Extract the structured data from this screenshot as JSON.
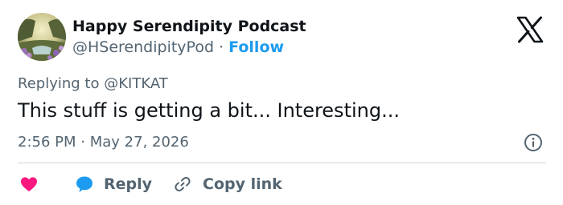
{
  "header": {
    "display_name": "Happy Serendipity Podcast",
    "handle": "@HSerendipityPod",
    "separator": "·",
    "follow_label": "Follow",
    "platform_icon": "x-logo-icon",
    "avatar_icon": "avatar-garden-image"
  },
  "tweet": {
    "reply_prefix": "Replying to",
    "reply_to": "@KITKAT",
    "text": "This stuff is getting a bit... Interesting...",
    "time": "2:56 PM",
    "date_separator": "·",
    "date": "May 27, 2026",
    "info_icon": "info-icon"
  },
  "actions": {
    "like_icon": "heart-icon",
    "like_color": "#f91880",
    "reply_icon": "speech-bubble-icon",
    "reply_color": "#1d9bf0",
    "reply_label": "Reply",
    "copy_icon": "link-icon",
    "copy_label": "Copy link"
  },
  "colors": {
    "text": "#0f1419",
    "secondary": "#536471",
    "accent": "#1d9bf0",
    "divider": "#cfd9de"
  }
}
